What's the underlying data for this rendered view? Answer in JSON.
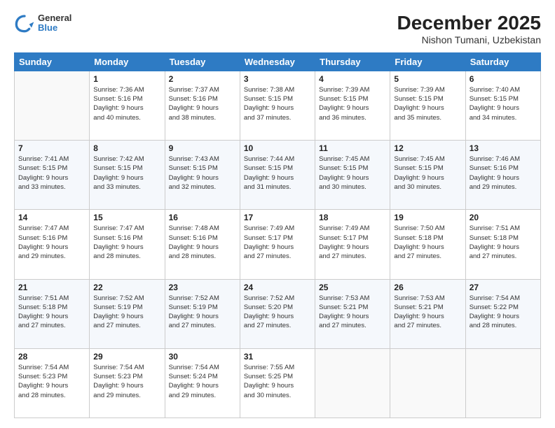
{
  "header": {
    "logo_line1": "General",
    "logo_line2": "Blue",
    "title": "December 2025",
    "subtitle": "Nishon Tumani, Uzbekistan"
  },
  "weekdays": [
    "Sunday",
    "Monday",
    "Tuesday",
    "Wednesday",
    "Thursday",
    "Friday",
    "Saturday"
  ],
  "weeks": [
    [
      {
        "day": "",
        "detail": ""
      },
      {
        "day": "1",
        "detail": "Sunrise: 7:36 AM\nSunset: 5:16 PM\nDaylight: 9 hours\nand 40 minutes."
      },
      {
        "day": "2",
        "detail": "Sunrise: 7:37 AM\nSunset: 5:16 PM\nDaylight: 9 hours\nand 38 minutes."
      },
      {
        "day": "3",
        "detail": "Sunrise: 7:38 AM\nSunset: 5:15 PM\nDaylight: 9 hours\nand 37 minutes."
      },
      {
        "day": "4",
        "detail": "Sunrise: 7:39 AM\nSunset: 5:15 PM\nDaylight: 9 hours\nand 36 minutes."
      },
      {
        "day": "5",
        "detail": "Sunrise: 7:39 AM\nSunset: 5:15 PM\nDaylight: 9 hours\nand 35 minutes."
      },
      {
        "day": "6",
        "detail": "Sunrise: 7:40 AM\nSunset: 5:15 PM\nDaylight: 9 hours\nand 34 minutes."
      }
    ],
    [
      {
        "day": "7",
        "detail": "Sunrise: 7:41 AM\nSunset: 5:15 PM\nDaylight: 9 hours\nand 33 minutes."
      },
      {
        "day": "8",
        "detail": "Sunrise: 7:42 AM\nSunset: 5:15 PM\nDaylight: 9 hours\nand 33 minutes."
      },
      {
        "day": "9",
        "detail": "Sunrise: 7:43 AM\nSunset: 5:15 PM\nDaylight: 9 hours\nand 32 minutes."
      },
      {
        "day": "10",
        "detail": "Sunrise: 7:44 AM\nSunset: 5:15 PM\nDaylight: 9 hours\nand 31 minutes."
      },
      {
        "day": "11",
        "detail": "Sunrise: 7:45 AM\nSunset: 5:15 PM\nDaylight: 9 hours\nand 30 minutes."
      },
      {
        "day": "12",
        "detail": "Sunrise: 7:45 AM\nSunset: 5:15 PM\nDaylight: 9 hours\nand 30 minutes."
      },
      {
        "day": "13",
        "detail": "Sunrise: 7:46 AM\nSunset: 5:16 PM\nDaylight: 9 hours\nand 29 minutes."
      }
    ],
    [
      {
        "day": "14",
        "detail": "Sunrise: 7:47 AM\nSunset: 5:16 PM\nDaylight: 9 hours\nand 29 minutes."
      },
      {
        "day": "15",
        "detail": "Sunrise: 7:47 AM\nSunset: 5:16 PM\nDaylight: 9 hours\nand 28 minutes."
      },
      {
        "day": "16",
        "detail": "Sunrise: 7:48 AM\nSunset: 5:16 PM\nDaylight: 9 hours\nand 28 minutes."
      },
      {
        "day": "17",
        "detail": "Sunrise: 7:49 AM\nSunset: 5:17 PM\nDaylight: 9 hours\nand 27 minutes."
      },
      {
        "day": "18",
        "detail": "Sunrise: 7:49 AM\nSunset: 5:17 PM\nDaylight: 9 hours\nand 27 minutes."
      },
      {
        "day": "19",
        "detail": "Sunrise: 7:50 AM\nSunset: 5:18 PM\nDaylight: 9 hours\nand 27 minutes."
      },
      {
        "day": "20",
        "detail": "Sunrise: 7:51 AM\nSunset: 5:18 PM\nDaylight: 9 hours\nand 27 minutes."
      }
    ],
    [
      {
        "day": "21",
        "detail": "Sunrise: 7:51 AM\nSunset: 5:18 PM\nDaylight: 9 hours\nand 27 minutes."
      },
      {
        "day": "22",
        "detail": "Sunrise: 7:52 AM\nSunset: 5:19 PM\nDaylight: 9 hours\nand 27 minutes."
      },
      {
        "day": "23",
        "detail": "Sunrise: 7:52 AM\nSunset: 5:19 PM\nDaylight: 9 hours\nand 27 minutes."
      },
      {
        "day": "24",
        "detail": "Sunrise: 7:52 AM\nSunset: 5:20 PM\nDaylight: 9 hours\nand 27 minutes."
      },
      {
        "day": "25",
        "detail": "Sunrise: 7:53 AM\nSunset: 5:21 PM\nDaylight: 9 hours\nand 27 minutes."
      },
      {
        "day": "26",
        "detail": "Sunrise: 7:53 AM\nSunset: 5:21 PM\nDaylight: 9 hours\nand 27 minutes."
      },
      {
        "day": "27",
        "detail": "Sunrise: 7:54 AM\nSunset: 5:22 PM\nDaylight: 9 hours\nand 28 minutes."
      }
    ],
    [
      {
        "day": "28",
        "detail": "Sunrise: 7:54 AM\nSunset: 5:23 PM\nDaylight: 9 hours\nand 28 minutes."
      },
      {
        "day": "29",
        "detail": "Sunrise: 7:54 AM\nSunset: 5:23 PM\nDaylight: 9 hours\nand 29 minutes."
      },
      {
        "day": "30",
        "detail": "Sunrise: 7:54 AM\nSunset: 5:24 PM\nDaylight: 9 hours\nand 29 minutes."
      },
      {
        "day": "31",
        "detail": "Sunrise: 7:55 AM\nSunset: 5:25 PM\nDaylight: 9 hours\nand 30 minutes."
      },
      {
        "day": "",
        "detail": ""
      },
      {
        "day": "",
        "detail": ""
      },
      {
        "day": "",
        "detail": ""
      }
    ]
  ]
}
